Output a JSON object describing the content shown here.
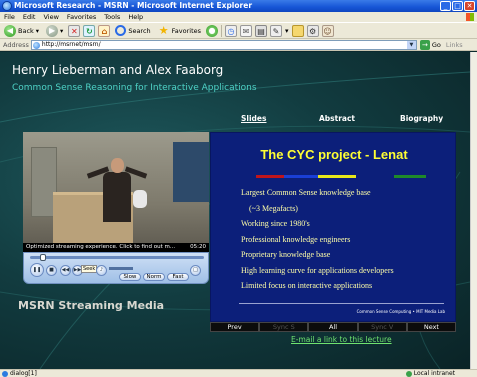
{
  "window": {
    "title": "Microsoft Research - MSRN - Microsoft Internet Explorer"
  },
  "menu": [
    "File",
    "Edit",
    "View",
    "Favorites",
    "Tools",
    "Help"
  ],
  "toolbar": {
    "back_label": "Back",
    "search_label": "Search",
    "favorites_label": "Favorites"
  },
  "address": {
    "label": "Address",
    "url": "http://msrnet/msrn/",
    "go_label": "Go",
    "links_label": "Links"
  },
  "page": {
    "speaker": "Henry Lieberman and Alex Faaborg",
    "talk_title": "Common Sense Reasoning for Interactive Applications",
    "tabs": [
      "Slides",
      "Abstract",
      "Biography"
    ],
    "msrn_label": "MSRN Streaming Media",
    "email_link": "E-mail a link to this lecture"
  },
  "video": {
    "status_text": "Optimized streaming experience. Click to find out m...",
    "time": "05:20",
    "seek_tooltip": "Seek",
    "pills": [
      "Slow",
      "Norm",
      "Fast"
    ]
  },
  "slide": {
    "title": "The CYC project - Lenat",
    "colors": [
      "#c0151b",
      "#1a3fd6",
      "#e8e81a",
      "#1f8a2a"
    ],
    "bullets": [
      "Largest Common Sense knowledge base",
      "(~3 Megafacts)",
      "Working since 1980's",
      "Professional knowledge engineers",
      "Proprietary knowledge base",
      "High learning curve for applications developers",
      "Limited focus on interactive applications"
    ],
    "footer": "Common Sense Computing • MIT Media Lab"
  },
  "slide_nav": {
    "prev": "Prev",
    "sync_s": "Sync S",
    "all": "All",
    "sync_v": "Sync V",
    "next": "Next"
  },
  "status": {
    "left": "dialog[1]",
    "zone": "Local intranet"
  }
}
